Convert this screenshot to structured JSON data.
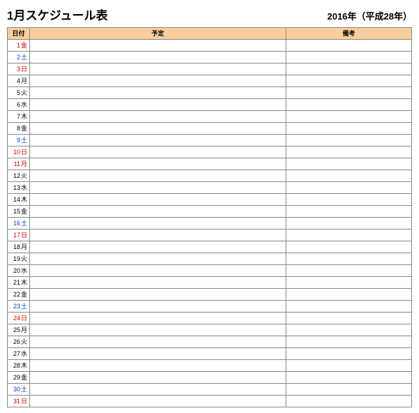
{
  "header": {
    "title": "1月スケジュール表",
    "year": "2016年（平成28年）"
  },
  "columns": {
    "date": "日付",
    "plan": "予定",
    "notes": "備考"
  },
  "days": [
    {
      "num": "1",
      "dow": "金",
      "color": "red",
      "plan": "",
      "notes": ""
    },
    {
      "num": "2",
      "dow": "土",
      "color": "blue",
      "plan": "",
      "notes": ""
    },
    {
      "num": "3",
      "dow": "日",
      "color": "red",
      "plan": "",
      "notes": ""
    },
    {
      "num": "4",
      "dow": "月",
      "color": "black",
      "plan": "",
      "notes": ""
    },
    {
      "num": "5",
      "dow": "火",
      "color": "black",
      "plan": "",
      "notes": ""
    },
    {
      "num": "6",
      "dow": "水",
      "color": "black",
      "plan": "",
      "notes": ""
    },
    {
      "num": "7",
      "dow": "木",
      "color": "black",
      "plan": "",
      "notes": ""
    },
    {
      "num": "8",
      "dow": "金",
      "color": "black",
      "plan": "",
      "notes": ""
    },
    {
      "num": "9",
      "dow": "土",
      "color": "blue",
      "plan": "",
      "notes": ""
    },
    {
      "num": "10",
      "dow": "日",
      "color": "red",
      "plan": "",
      "notes": ""
    },
    {
      "num": "11",
      "dow": "月",
      "color": "red",
      "plan": "",
      "notes": ""
    },
    {
      "num": "12",
      "dow": "火",
      "color": "black",
      "plan": "",
      "notes": ""
    },
    {
      "num": "13",
      "dow": "水",
      "color": "black",
      "plan": "",
      "notes": ""
    },
    {
      "num": "14",
      "dow": "木",
      "color": "black",
      "plan": "",
      "notes": ""
    },
    {
      "num": "15",
      "dow": "金",
      "color": "black",
      "plan": "",
      "notes": ""
    },
    {
      "num": "16",
      "dow": "土",
      "color": "blue",
      "plan": "",
      "notes": ""
    },
    {
      "num": "17",
      "dow": "日",
      "color": "red",
      "plan": "",
      "notes": ""
    },
    {
      "num": "18",
      "dow": "月",
      "color": "black",
      "plan": "",
      "notes": ""
    },
    {
      "num": "19",
      "dow": "火",
      "color": "black",
      "plan": "",
      "notes": ""
    },
    {
      "num": "20",
      "dow": "水",
      "color": "black",
      "plan": "",
      "notes": ""
    },
    {
      "num": "21",
      "dow": "木",
      "color": "black",
      "plan": "",
      "notes": ""
    },
    {
      "num": "22",
      "dow": "金",
      "color": "black",
      "plan": "",
      "notes": ""
    },
    {
      "num": "23",
      "dow": "土",
      "color": "blue",
      "plan": "",
      "notes": ""
    },
    {
      "num": "24",
      "dow": "日",
      "color": "red",
      "plan": "",
      "notes": ""
    },
    {
      "num": "25",
      "dow": "月",
      "color": "black",
      "plan": "",
      "notes": ""
    },
    {
      "num": "26",
      "dow": "火",
      "color": "black",
      "plan": "",
      "notes": ""
    },
    {
      "num": "27",
      "dow": "水",
      "color": "black",
      "plan": "",
      "notes": ""
    },
    {
      "num": "28",
      "dow": "木",
      "color": "black",
      "plan": "",
      "notes": ""
    },
    {
      "num": "29",
      "dow": "金",
      "color": "black",
      "plan": "",
      "notes": ""
    },
    {
      "num": "30",
      "dow": "土",
      "color": "blue",
      "plan": "",
      "notes": ""
    },
    {
      "num": "31",
      "dow": "日",
      "color": "red",
      "plan": "",
      "notes": ""
    }
  ]
}
